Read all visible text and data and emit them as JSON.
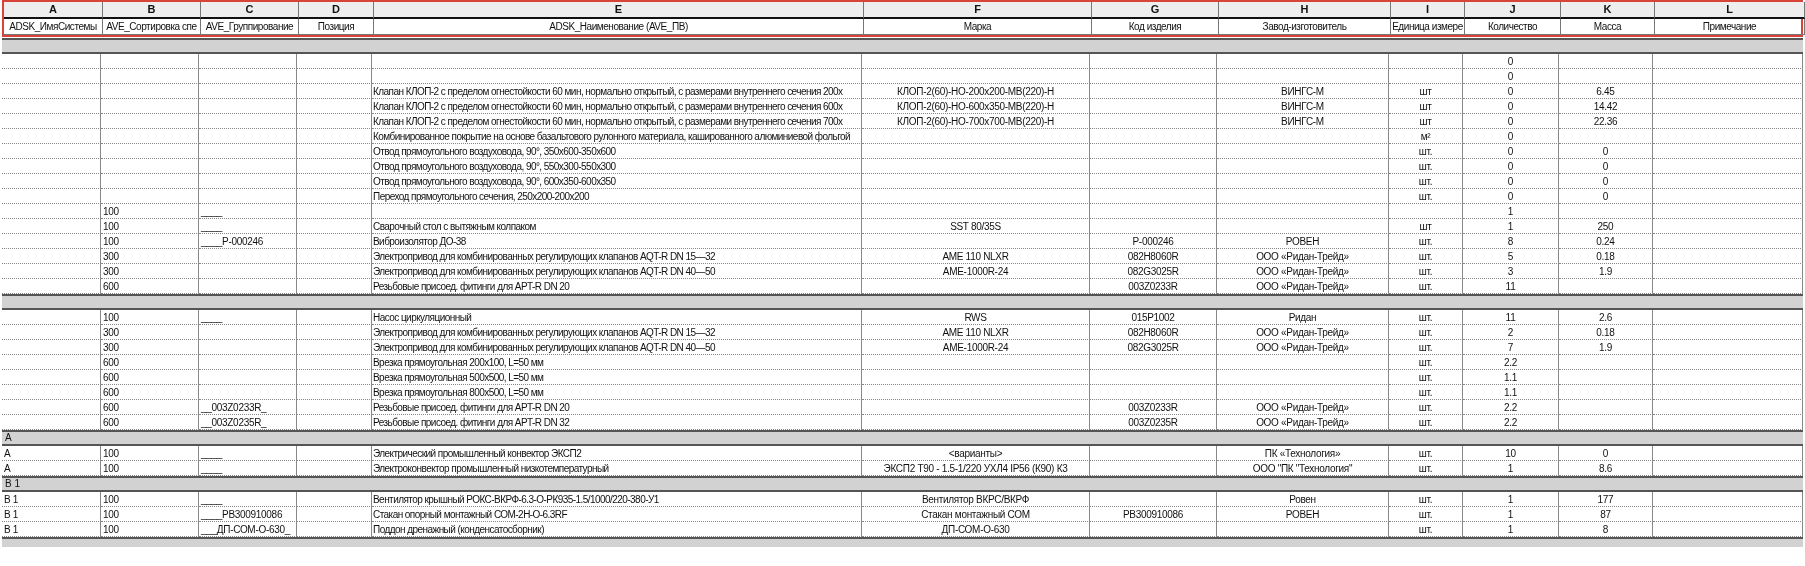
{
  "header_selected": true,
  "columns": [
    {
      "letter": "A",
      "title": "ADSK_ИмяСистемы"
    },
    {
      "letter": "B",
      "title": "AVE_Сортировка спе"
    },
    {
      "letter": "C",
      "title": "AVE_Группирование"
    },
    {
      "letter": "D",
      "title": "Позиция"
    },
    {
      "letter": "E",
      "title": "ADSK_Наименование (AVE_ПВ)"
    },
    {
      "letter": "F",
      "title": "Марка"
    },
    {
      "letter": "G",
      "title": "Код изделия"
    },
    {
      "letter": "H",
      "title": "Завод-изготовитель"
    },
    {
      "letter": "I",
      "title": "Единица измере"
    },
    {
      "letter": "J",
      "title": "Количество"
    },
    {
      "letter": "K",
      "title": "Масса"
    },
    {
      "letter": "L",
      "title": "Примечание"
    }
  ],
  "rows": [
    {
      "kind": "group"
    },
    {
      "kind": "item",
      "cells": {
        "J": "0"
      }
    },
    {
      "kind": "item",
      "cells": {
        "J": "0"
      }
    },
    {
      "kind": "item",
      "cells": {
        "E": "Клапан КЛОП-2 с пределом огнестойкости 60 мин, нормально открытый, с размерами внутреннего сечения 200х",
        "F": "КЛОП-2(60)-НО-200х200-МВ(220)-Н",
        "H": "ВИНГС-М",
        "I": "шт",
        "J": "0",
        "K": "6.45"
      }
    },
    {
      "kind": "item",
      "cells": {
        "E": "Клапан КЛОП-2 с пределом огнестойкости 60 мин, нормально открытый, с размерами внутреннего сечения 600х",
        "F": "КЛОП-2(60)-НО-600х350-МВ(220)-Н",
        "H": "ВИНГС-М",
        "I": "шт",
        "J": "0",
        "K": "14.42"
      }
    },
    {
      "kind": "item",
      "cells": {
        "E": "Клапан КЛОП-2 с пределом огнестойкости 60 мин, нормально открытый, с размерами внутреннего сечения 700х",
        "F": "КЛОП-2(60)-НО-700х700-МВ(220)-Н",
        "H": "ВИНГС-М",
        "I": "шт",
        "J": "0",
        "K": "22.36"
      }
    },
    {
      "kind": "item",
      "cells": {
        "E": "Комбинированное покрытие на основе базальтового рулонного материала, кашированного алюминиевой фольгой",
        "I": "м²",
        "J": "0"
      }
    },
    {
      "kind": "item",
      "cells": {
        "E": "Отвод прямоугольного воздуховода, 90°, 350х600-350х600",
        "I": "шт.",
        "J": "0",
        "K": "0"
      }
    },
    {
      "kind": "item",
      "cells": {
        "E": "Отвод прямоугольного воздуховода, 90°, 550х300-550х300",
        "I": "шт.",
        "J": "0",
        "K": "0"
      }
    },
    {
      "kind": "item",
      "cells": {
        "E": "Отвод прямоугольного воздуховода, 90°, 600х350-600х350",
        "I": "шт.",
        "J": "0",
        "K": "0"
      }
    },
    {
      "kind": "item",
      "cells": {
        "E": "Переход прямоугольного сечения, 250х200-200х200",
        "I": "шт.",
        "J": "0",
        "K": "0"
      }
    },
    {
      "kind": "item",
      "cells": {
        "B": "100",
        "C": "____",
        "J": "1"
      }
    },
    {
      "kind": "item",
      "cells": {
        "B": "100",
        "C": "____",
        "E": "Сварочный стол с вытяжным колпаком",
        "F": "SST 80/35S",
        "I": "шт",
        "J": "1",
        "K": "250"
      }
    },
    {
      "kind": "item",
      "cells": {
        "B": "100",
        "C": "____Р-000246",
        "E": "Виброизолятор ДО-38",
        "G": "Р-000246",
        "H": "РОВЕН",
        "I": "шт.",
        "J": "8",
        "K": "0.24"
      }
    },
    {
      "kind": "item",
      "cells": {
        "B": "300",
        "E": "Электропривод для комбинированных регулирующих клапанов AQT-R DN 15—32",
        "F": "AME 110 NLXR",
        "G": "082H8060R",
        "H": "ООО «Ридан-Трейд»",
        "I": "шт.",
        "J": "5",
        "K": "0.18"
      }
    },
    {
      "kind": "item",
      "cells": {
        "B": "300",
        "E": "Электропривод для комбинированных регулирующих клапанов AQT-R DN 40—50",
        "F": "AME-1000R-24",
        "G": "082G3025R",
        "H": "ООО «Ридан-Трейд»",
        "I": "шт.",
        "J": "3",
        "K": "1.9"
      }
    },
    {
      "kind": "item",
      "cells": {
        "B": "600",
        "E": "Резьбовые присоед. фитинги для APT-R DN 20",
        "G": "003Z0233R",
        "H": "ООО «Ридан-Трейд»",
        "I": "шт.",
        "J": "11"
      }
    },
    {
      "kind": "group"
    },
    {
      "kind": "item",
      "cells": {
        "B": "100",
        "C": "____",
        "E": "Насос циркуляционный",
        "F": "RWS",
        "G": "015P1002",
        "H": "Ридан",
        "I": "шт.",
        "J": "11",
        "K": "2.6"
      }
    },
    {
      "kind": "item",
      "cells": {
        "B": "300",
        "E": "Электропривод для комбинированных регулирующих клапанов AQT-R DN 15—32",
        "F": "AME 110 NLXR",
        "G": "082H8060R",
        "H": "ООО «Ридан-Трейд»",
        "I": "шт.",
        "J": "2",
        "K": "0.18"
      }
    },
    {
      "kind": "item",
      "cells": {
        "B": "300",
        "E": "Электропривод для комбинированных регулирующих клапанов AQT-R DN 40—50",
        "F": "AME-1000R-24",
        "G": "082G3025R",
        "H": "ООО «Ридан-Трейд»",
        "I": "шт.",
        "J": "7",
        "K": "1.9"
      }
    },
    {
      "kind": "item",
      "cells": {
        "B": "600",
        "E": "Врезка прямоугольная 200х100, L=50 мм",
        "I": "шт.",
        "J": "2.2"
      }
    },
    {
      "kind": "item",
      "cells": {
        "B": "600",
        "E": "Врезка прямоугольная 500х500, L=50 мм",
        "I": "шт.",
        "J": "1.1"
      }
    },
    {
      "kind": "item",
      "cells": {
        "B": "600",
        "E": "Врезка прямоугольная 800х500, L=50 мм",
        "I": "шт.",
        "J": "1.1"
      }
    },
    {
      "kind": "item",
      "cells": {
        "B": "600",
        "C": "__003Z0233R_",
        "E": "Резьбовые присоед. фитинги для APT-R DN 20",
        "G": "003Z0233R",
        "H": "ООО «Ридан-Трейд»",
        "I": "шт.",
        "J": "2.2"
      }
    },
    {
      "kind": "item",
      "cells": {
        "B": "600",
        "C": "__003Z0235R_",
        "E": "Резьбовые присоед. фитинги для APT-R DN 32",
        "G": "003Z0235R",
        "H": "ООО «Ридан-Трейд»",
        "I": "шт.",
        "J": "2.2"
      }
    },
    {
      "kind": "group",
      "label": "А"
    },
    {
      "kind": "item",
      "cells": {
        "A": "А",
        "B": "100",
        "C": "____",
        "E": "Электрический промышленный конвектор ЭКСП2",
        "F": "<варианты>",
        "H": "ПК «Технология»",
        "I": "шт.",
        "J": "10",
        "K": "0"
      }
    },
    {
      "kind": "item",
      "cells": {
        "A": "А",
        "B": "100",
        "C": "____",
        "E": "Электроконвектор промышленный низкотемпературный",
        "F": "ЭКСП2 Т90 - 1.5-1/220 УХЛ4  IP56 (К90) К3",
        "H": "ООО \"ПК \"Технология\"",
        "I": "шт.",
        "J": "1",
        "K": "8.6"
      }
    },
    {
      "kind": "group",
      "label": "В 1"
    },
    {
      "kind": "item",
      "cells": {
        "A": "В 1",
        "B": "100",
        "C": "____",
        "E": "Вентилятор крышный РОКС-ВКРФ-6.3-О-РК935-1.5/1000/220-380-У1",
        "F": "Вентилятор ВКРС/ВКРФ",
        "H": "Ровен",
        "I": "шт.",
        "J": "1",
        "K": "177"
      }
    },
    {
      "kind": "item",
      "cells": {
        "A": "В 1",
        "B": "100",
        "C": "____РВ300910086",
        "E": "Стакан опорный монтажный СОМ-2Н-О-6.3RF",
        "F": "Стакан монтажный СОМ",
        "G": "РВ300910086",
        "H": "РОВЕН",
        "I": "шт.",
        "J": "1",
        "K": "87"
      }
    },
    {
      "kind": "item",
      "cells": {
        "A": "В 1",
        "B": "100",
        "C": "___ДП-СОМ-О-630_",
        "E": "Поддон дренажный (конденсатосборник)",
        "F": "ДП-СОМ-О-630",
        "I": "шт.",
        "J": "1",
        "K": "8"
      }
    },
    {
      "kind": "group",
      "partial": true
    }
  ]
}
